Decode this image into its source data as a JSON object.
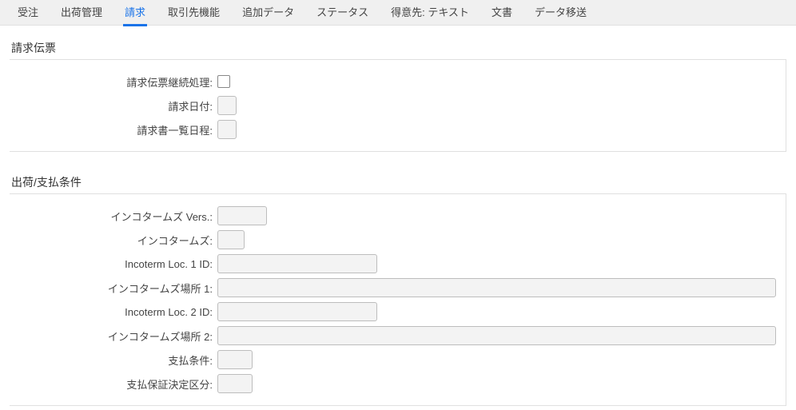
{
  "tabs": [
    {
      "label": "受注"
    },
    {
      "label": "出荷管理"
    },
    {
      "label": "請求",
      "active": true
    },
    {
      "label": "取引先機能"
    },
    {
      "label": "追加データ"
    },
    {
      "label": "ステータス"
    },
    {
      "label": "得意先: テキスト"
    },
    {
      "label": "文書"
    },
    {
      "label": "データ移送"
    }
  ],
  "section1": {
    "title": "請求伝票",
    "rows": {
      "cont": "請求伝票継続処理:",
      "date": "請求日付:",
      "list": "請求書一覧日程:"
    }
  },
  "section2": {
    "title": "出荷/支払条件",
    "rows": {
      "incov": "インコタームズ Vers.:",
      "inco": "インコタームズ:",
      "loc1id": "Incoterm Loc. 1 ID:",
      "loc1": "インコタームズ場所 1:",
      "loc2id": "Incoterm Loc. 2 ID:",
      "loc2": "インコタームズ場所 2:",
      "payterm": "支払条件:",
      "payguar": "支払保証決定区分:"
    }
  },
  "values": {
    "cont_checked": false,
    "date": "",
    "list": "",
    "incov": "",
    "inco": "",
    "loc1id": "",
    "loc1": "",
    "loc2id": "",
    "loc2": "",
    "payterm": "",
    "payguar": ""
  }
}
